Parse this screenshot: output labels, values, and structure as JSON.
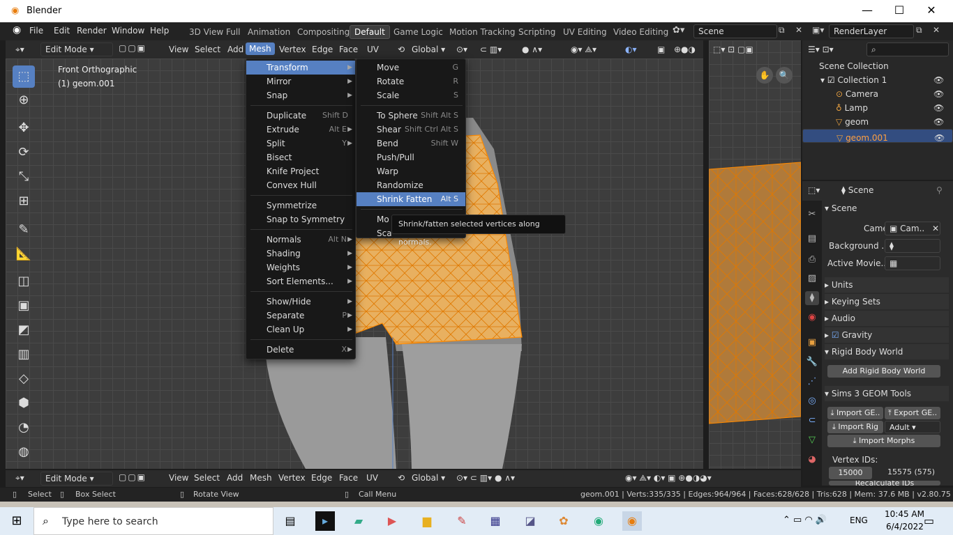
{
  "window": {
    "title": "Blender",
    "minimize": "—",
    "maximize": "☐",
    "close": "✕"
  },
  "topmenu": [
    "File",
    "Edit",
    "Render",
    "Window",
    "Help"
  ],
  "workspaces": [
    "3D View Full",
    "Animation",
    "Compositing",
    "Default",
    "Game Logic",
    "Motion Tracking",
    "Scripting",
    "UV Editing",
    "Video Editing"
  ],
  "scene_field": "Scene",
  "renderlayer_field": "RenderLayer",
  "vheader": {
    "mode": "Edit Mode",
    "view": "View",
    "select": "Select",
    "add": "Add",
    "mesh": "Mesh",
    "vertex": "Vertex",
    "edge": "Edge",
    "face": "Face",
    "uv": "UV",
    "orientation": "Global"
  },
  "viewport": {
    "label1": "Front Orthographic",
    "label2": "(1) geom.001"
  },
  "mesh_menu": {
    "items": [
      {
        "label": "Transform",
        "shortcut": "",
        "sub": true,
        "hl": true
      },
      {
        "label": "Mirror",
        "shortcut": "",
        "sub": true
      },
      {
        "label": "Snap",
        "shortcut": "",
        "sub": true
      },
      {
        "sep": true
      },
      {
        "label": "Duplicate",
        "shortcut": "Shift D"
      },
      {
        "label": "Extrude",
        "shortcut": "Alt E",
        "sub": true
      },
      {
        "label": "Split",
        "shortcut": "Y",
        "sub": true
      },
      {
        "label": "Bisect",
        "shortcut": ""
      },
      {
        "label": "Knife Project",
        "shortcut": ""
      },
      {
        "label": "Convex Hull",
        "shortcut": ""
      },
      {
        "sep": true
      },
      {
        "label": "Symmetrize",
        "shortcut": ""
      },
      {
        "label": "Snap to Symmetry",
        "shortcut": ""
      },
      {
        "sep": true
      },
      {
        "label": "Normals",
        "shortcut": "Alt N",
        "sub": true
      },
      {
        "label": "Shading",
        "shortcut": "",
        "sub": true
      },
      {
        "label": "Weights",
        "shortcut": "",
        "sub": true
      },
      {
        "label": "Sort Elements...",
        "shortcut": "",
        "sub": true
      },
      {
        "sep": true
      },
      {
        "label": "Show/Hide",
        "shortcut": "",
        "sub": true
      },
      {
        "label": "Separate",
        "shortcut": "P",
        "sub": true
      },
      {
        "label": "Clean Up",
        "shortcut": "",
        "sub": true
      },
      {
        "sep": true
      },
      {
        "label": "Delete",
        "shortcut": "X",
        "sub": true
      }
    ]
  },
  "transform_menu": {
    "items": [
      {
        "label": "Move",
        "shortcut": "G"
      },
      {
        "label": "Rotate",
        "shortcut": "R"
      },
      {
        "label": "Scale",
        "shortcut": "S"
      },
      {
        "sep": true
      },
      {
        "label": "To Sphere",
        "shortcut": "Shift Alt S"
      },
      {
        "label": "Shear",
        "shortcut": "Shift Ctrl Alt S"
      },
      {
        "label": "Bend",
        "shortcut": "Shift W"
      },
      {
        "label": "Push/Pull",
        "shortcut": ""
      },
      {
        "label": "Warp",
        "shortcut": ""
      },
      {
        "label": "Randomize",
        "shortcut": ""
      },
      {
        "label": "Shrink Fatten",
        "shortcut": "Alt S",
        "hl": true
      },
      {
        "sep": true
      },
      {
        "label": "Mo",
        "shortcut": ""
      },
      {
        "label": "Sca",
        "shortcut": ""
      }
    ]
  },
  "tooltip": "Shrink/fatten selected vertices along normals.",
  "outliner": {
    "root": "Scene Collection",
    "collection": "Collection 1",
    "objects": [
      {
        "name": "Camera",
        "icon": "camera-icon"
      },
      {
        "name": "Lamp",
        "icon": "lamp-icon"
      },
      {
        "name": "geom",
        "icon": "mesh-icon"
      },
      {
        "name": "geom.001",
        "icon": "mesh-icon",
        "selected": true
      }
    ]
  },
  "props": {
    "context": "Scene",
    "sections": {
      "scene": "Scene",
      "camera_label": "Camera",
      "camera_value": "Cam..",
      "background_label": "Background ..",
      "active_movie_label": "Active Movie..",
      "units": "Units",
      "keying": "Keying Sets",
      "audio": "Audio",
      "gravity": "Gravity",
      "rigid": "Rigid Body World",
      "add_rigid": "Add Rigid Body World",
      "sims": "Sims 3 GEOM Tools",
      "import_ge": "Import GE..",
      "export_ge": "Export GE..",
      "import_rig": "Import Rig",
      "adult": "Adult",
      "import_morphs": "Import Morphs",
      "vertex_ids": "Vertex IDs:",
      "vid1": "15000",
      "vid2": "15575 (575)",
      "recalc": "Recalculate IDs"
    }
  },
  "status": {
    "select": "Select",
    "box_select": "Box Select",
    "rotate_view": "Rotate View",
    "call_menu": "Call Menu",
    "stats": "geom.001 | Verts:335/335 | Edges:964/964 | Faces:628/628 | Tris:628 | Mem: 37.6 MB | v2.80.75"
  },
  "taskbar": {
    "search": "Type here to search",
    "time": "10:45 AM",
    "date": "6/4/2022",
    "lang": "ENG"
  },
  "colors": {
    "accent": "#5680c2",
    "mesh": "#e8a040",
    "wire": "#ff8a00"
  }
}
